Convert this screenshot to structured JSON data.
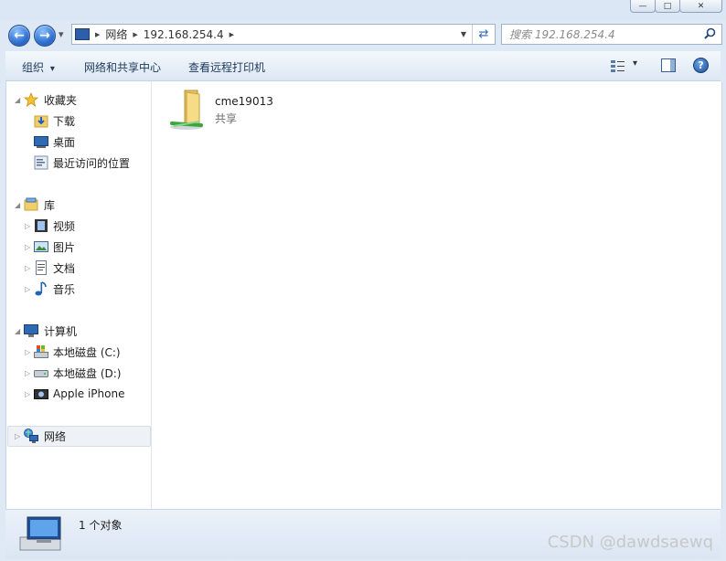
{
  "window": {
    "minimize_glyph": "—",
    "maximize_glyph": "□",
    "close_glyph": "✕"
  },
  "navigation": {
    "back_glyph": "←",
    "forward_glyph": "→",
    "recent_glyph": "▾"
  },
  "address": {
    "segments": [
      "网络",
      "192.168.254.4"
    ],
    "separator": "▶",
    "dropdown_glyph": "▼",
    "refresh_glyph": "⇄"
  },
  "search": {
    "placeholder": "搜索 192.168.254.4"
  },
  "toolbar": {
    "organize": "组织",
    "organize_arrow": "▾",
    "network_center": "网络和共享中心",
    "view_printers": "查看远程打印机",
    "view_arrow": "▾",
    "help_glyph": "?"
  },
  "sidebar": {
    "groups": [
      {
        "label": "收藏夹",
        "items": [
          "下载",
          "桌面",
          "最近访问的位置"
        ]
      },
      {
        "label": "库",
        "items": [
          "视频",
          "图片",
          "文档",
          "音乐"
        ]
      },
      {
        "label": "计算机",
        "items": [
          "本地磁盘 (C:)",
          "本地磁盘 (D:)",
          "Apple iPhone"
        ]
      },
      {
        "label": "网络",
        "items": []
      }
    ],
    "expanded_glyph": "◢",
    "collapsed_glyph": "▷"
  },
  "main": {
    "items": [
      {
        "name": "cme19013",
        "type": "共享"
      }
    ]
  },
  "status": {
    "text": "1 个对象"
  },
  "watermark": "CSDN @dawdsaewq",
  "colors": {
    "accent": "#1e395b",
    "selection": "#eef2f6",
    "folder": "#f3d57a"
  }
}
